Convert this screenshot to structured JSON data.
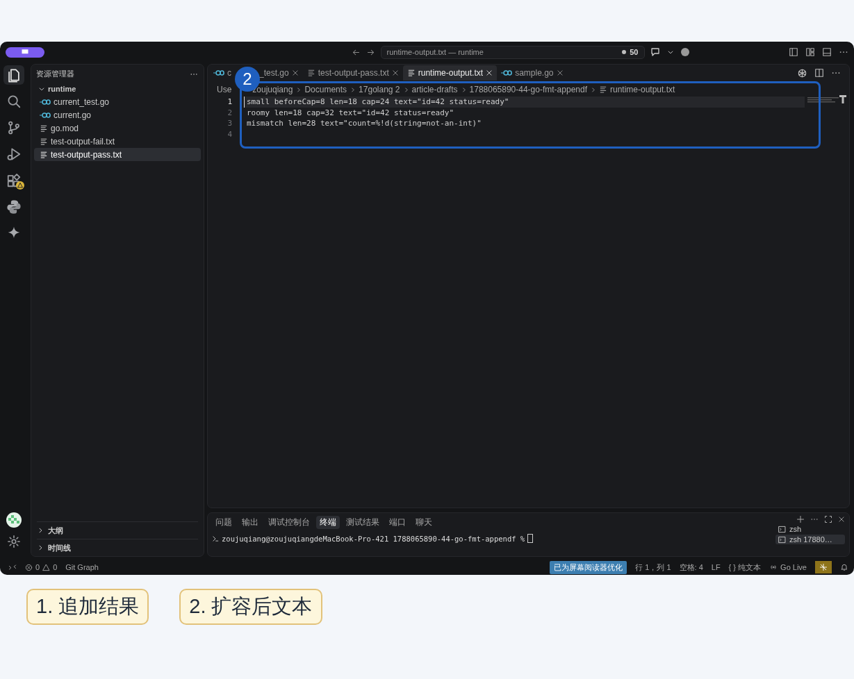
{
  "title_bar": {
    "search": "runtime-output.txt — runtime",
    "count": "50"
  },
  "activity_bar": [
    {
      "kind": "explorer",
      "selected": true,
      "warning": false
    },
    {
      "kind": "search",
      "selected": false,
      "warning": false
    },
    {
      "kind": "source-control",
      "selected": false,
      "warning": false
    },
    {
      "kind": "run",
      "selected": false,
      "warning": false
    },
    {
      "kind": "extensions",
      "selected": false,
      "warning": true
    },
    {
      "kind": "python",
      "selected": false,
      "warning": false
    },
    {
      "kind": "sparkle",
      "selected": false,
      "warning": false
    }
  ],
  "sidebar": {
    "title": "资源管理器",
    "tree": [
      {
        "label": "runtime",
        "kind": "folder",
        "expanded": true,
        "selected": false,
        "children": [
          {
            "label": "current_test.go",
            "kind": "go",
            "selected": false
          },
          {
            "label": "current.go",
            "kind": "go",
            "selected": false
          },
          {
            "label": "go.mod",
            "kind": "text",
            "selected": false
          },
          {
            "label": "test-output-fail.txt",
            "kind": "text",
            "selected": false
          },
          {
            "label": "test-output-pass.txt",
            "kind": "text",
            "selected": true
          }
        ]
      }
    ],
    "sections": [
      {
        "label": "大纲",
        "expanded": false
      },
      {
        "label": "时间线",
        "expanded": false
      }
    ]
  },
  "tabs": [
    {
      "label_parts": [
        "c",
        "_test.go"
      ],
      "kind": "go",
      "selected": false
    },
    {
      "label": "test-output-pass.txt",
      "kind": "text",
      "selected": false
    },
    {
      "label": "runtime-output.txt",
      "kind": "text",
      "selected": true
    },
    {
      "label": "sample.go",
      "kind": "go",
      "selected": false
    }
  ],
  "breadcrumb": [
    "Use",
    "zoujuqiang",
    "Documents",
    "17golang 2",
    "article-drafts",
    "1788065890-44-go-fmt-appendf",
    "runtime-output.txt"
  ],
  "editor": {
    "lines": [
      {
        "number": "1",
        "text": "small beforeCap=8 len=18 cap=24 text=\"id=42 status=ready\"",
        "current": true
      },
      {
        "number": "2",
        "text": "roomy len=18 cap=32 text=\"id=42 status=ready\"",
        "current": false
      },
      {
        "number": "3",
        "text": "mismatch len=28 text=\"count=%!d(string=not-an-int)\"",
        "current": false
      },
      {
        "number": "4",
        "current": false
      }
    ]
  },
  "panel": {
    "tabs": [
      {
        "label": "问题",
        "selected": false
      },
      {
        "label": "输出",
        "selected": false
      },
      {
        "label": "调试控制台",
        "selected": false
      },
      {
        "label": "终端",
        "selected": true
      },
      {
        "label": "测试结果",
        "selected": false
      },
      {
        "label": "端口",
        "selected": false
      },
      {
        "label": "聊天",
        "selected": false
      }
    ],
    "terminal_line": "zoujuqiang@zoujuqiangdeMacBook-Pro-421 1788065890-44-go-fmt-appendf %",
    "terminals": [
      {
        "label": "zsh",
        "selected": false
      },
      {
        "label": "zsh 17880…",
        "selected": true
      }
    ]
  },
  "status_bar": {
    "errors": "0",
    "warnings": "0",
    "left": [
      "Git Graph"
    ],
    "right": [
      {
        "label": "已为屏幕阅读器优化",
        "kind": "highlight"
      },
      {
        "label": "行 1，列 1",
        "kind": "plain"
      },
      {
        "label": "空格: 4",
        "kind": "plain"
      },
      {
        "label": "LF",
        "kind": "plain"
      },
      {
        "label": "{ } 纯文本",
        "kind": "plain"
      },
      {
        "label": "Go Live",
        "kind": "live"
      }
    ]
  },
  "annotations": {
    "badge": "2",
    "labels": [
      "1. 追加结果",
      "2. 扩容后文本"
    ]
  }
}
